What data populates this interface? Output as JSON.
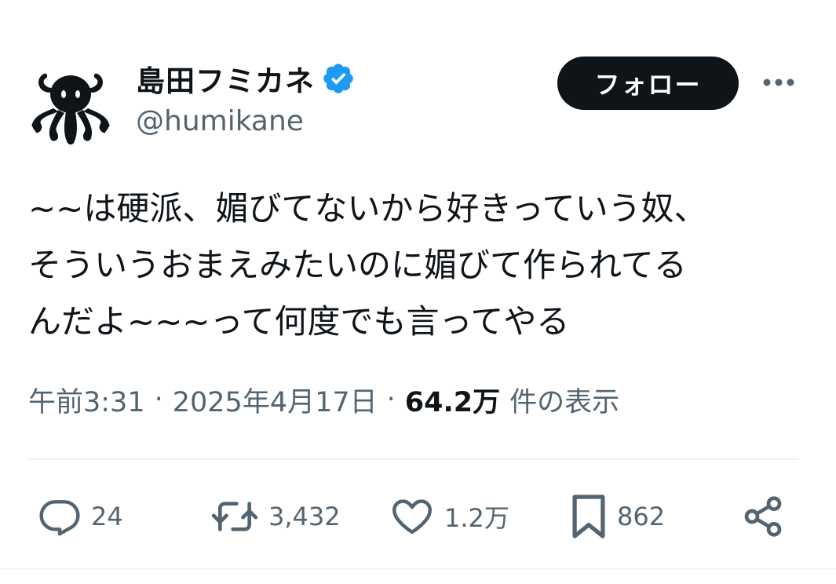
{
  "author": {
    "display_name": "島田フミカネ",
    "handle": "@humikane",
    "verified_icon": "verified-badge-icon",
    "avatar_icon": "octopus-avatar"
  },
  "header": {
    "follow_label": "フォロー",
    "more_icon": "more-icon"
  },
  "tweet": {
    "lines": [
      "~~は硬派、媚びてないから好きっていう奴、",
      "そういうおまえみたいのに媚びて作られてる",
      "んだよ~~~って何度でも言ってやる"
    ]
  },
  "meta": {
    "time": "午前3:31",
    "separator": "·",
    "date": "2025年4月17日",
    "views_count": "64.2万",
    "views_label": "件の表示"
  },
  "actions": {
    "reply_count": "24",
    "retweet_count": "3,432",
    "like_count": "1.2万",
    "bookmark_count": "862",
    "icons": [
      "reply-icon",
      "retweet-icon",
      "like-icon",
      "bookmark-icon",
      "share-icon"
    ]
  },
  "colors": {
    "text": "#0f1419",
    "secondary": "#536471",
    "verified": "#1d9bf0",
    "follow_bg": "#0f1419",
    "divider": "#eff3f4"
  }
}
